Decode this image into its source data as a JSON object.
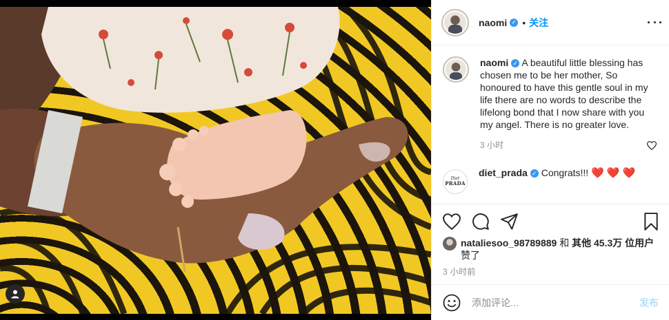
{
  "colors": {
    "accent": "#0095f6",
    "verified": "#3897f0",
    "heart": "#e0245e",
    "muted": "#8e8e8e",
    "post_disabled": "#b2dffc"
  },
  "photo": {
    "tag_icon": "user-tag-icon"
  },
  "header": {
    "username": "naomi",
    "dot": "•",
    "follow_label": "关注",
    "more_icon": "more-options-icon"
  },
  "caption": {
    "username": "naomi",
    "text": "A beautiful little blessing has chosen me to be her mother, So honoured to have this gentle soul in my life there are no words to describe the lifelong bond that I now share with you my angel. There is no greater love.",
    "time": "3 小时"
  },
  "comment": {
    "username": "diet_prada",
    "text": "Congrats!!!",
    "hearts": "❤️ ❤️ ❤️",
    "avatar_small": "Diet",
    "avatar_big": "PRADA"
  },
  "actions": {
    "like_icon": "heart-outline-icon",
    "comment_icon": "comment-icon",
    "share_icon": "share-icon",
    "save_icon": "bookmark-icon"
  },
  "likes": {
    "user": "nataliesoo_98789889",
    "connector": "和",
    "others": "其他 45.3万 位用户",
    "suffix": "赞了"
  },
  "timestamp": "3 小时前",
  "add_comment": {
    "placeholder": "添加评论...",
    "post_label": "发布"
  }
}
